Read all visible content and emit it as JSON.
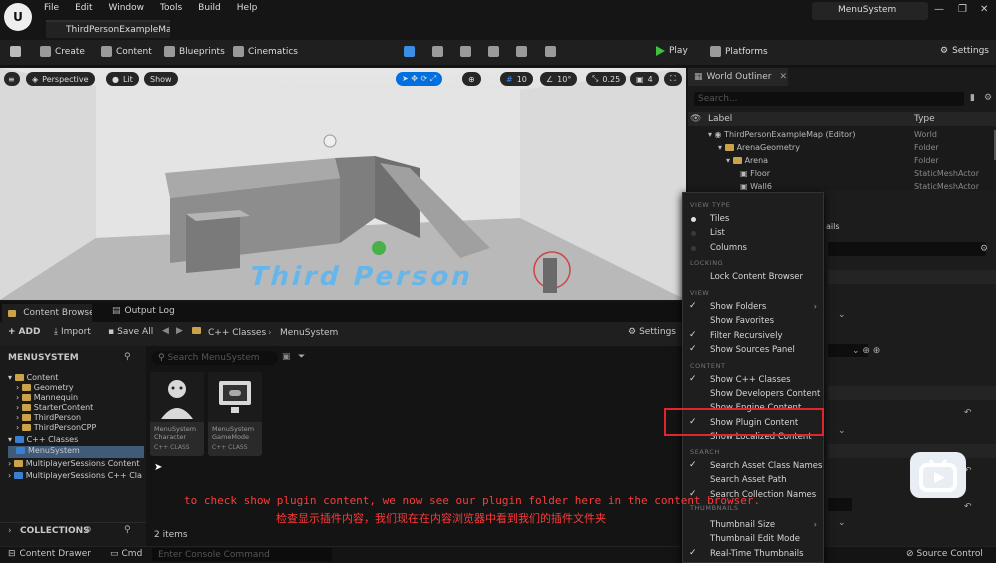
{
  "menubar": {
    "items": [
      "File",
      "Edit",
      "Window",
      "Tools",
      "Build",
      "Help"
    ],
    "project": "MenuSystem"
  },
  "doc_tab": "ThirdPersonExampleMap",
  "toolbar": {
    "create": "Create",
    "content": "Content",
    "blueprints": "Blueprints",
    "cinematics": "Cinematics",
    "play": "Play",
    "platforms": "Platforms",
    "settings": "Settings"
  },
  "viewport": {
    "perspective": "Perspective",
    "lit": "Lit",
    "show": "Show",
    "grid": "10",
    "angle": "10°",
    "scale": "0.25",
    "cams": "4",
    "floor_text": "Third Person"
  },
  "outliner": {
    "title": "World Outliner",
    "search_placeholder": "Search...",
    "col_label": "Label",
    "col_type": "Type",
    "rows": [
      {
        "label": "ThirdPersonExampleMap (Editor)",
        "type": "World"
      },
      {
        "label": "ArenaGeometry",
        "type": "Folder"
      },
      {
        "label": "Arena",
        "type": "Folder"
      },
      {
        "label": "Floor",
        "type": "StaticMeshActor"
      },
      {
        "label": "Wall6",
        "type": "StaticMeshActor"
      }
    ],
    "details_fragment": "ails"
  },
  "content_browser": {
    "tab": "Content Browser",
    "output_log": "Output Log",
    "add": "ADD",
    "import": "Import",
    "save_all": "Save All",
    "path": [
      "C++ Classes",
      "MenuSystem"
    ],
    "settings": "Settings",
    "root": "MENUSYSTEM",
    "search_placeholder": "Search MenuSystem",
    "tree": [
      "Content",
      "Geometry",
      "Mannequin",
      "StarterContent",
      "ThirdPerson",
      "ThirdPersonCPP",
      "C++ Classes",
      "MenuSystem",
      "MultiplayerSessions Content",
      "MultiplayerSessions C++ Cla"
    ],
    "items": [
      {
        "name": "MenuSystem Character",
        "type": "C++ CLASS"
      },
      {
        "name": "MenuSystem GameMode",
        "type": "C++ CLASS"
      }
    ],
    "count": "2 items",
    "collections": "COLLECTIONS"
  },
  "menu": {
    "view_type": "VIEW TYPE",
    "tiles": "Tiles",
    "list": "List",
    "columns": "Columns",
    "locking": "LOCKING",
    "lock": "Lock Content Browser",
    "view": "VIEW",
    "show_folders": "Show Folders",
    "show_favorites": "Show Favorites",
    "filter_recursively": "Filter Recursively",
    "show_sources_panel": "Show Sources Panel",
    "content": "CONTENT",
    "show_cpp": "Show C++ Classes",
    "show_developers": "Show Developers Content",
    "show_engine": "Show Engine Content",
    "show_plugin": "Show Plugin Content",
    "show_localized": "Show Localized Content",
    "search": "SEARCH",
    "search_class": "Search Asset Class Names",
    "search_path": "Search Asset Path",
    "search_collection": "Search Collection Names",
    "thumbnails": "THUMBNAILS",
    "thumb_size": "Thumbnail Size",
    "thumb_edit": "Thumbnail Edit Mode",
    "realtime": "Real-Time Thumbnails"
  },
  "status": {
    "content_drawer": "Content Drawer",
    "cmd": "Cmd",
    "console_placeholder": "Enter Console Command",
    "source_control": "Source Control"
  },
  "subtitles": {
    "en": "to check show plugin content, we now see our plugin folder here in the content browser.",
    "zh": "检查显示插件内容，我们现在在内容浏览器中看到我们的插件文件夹"
  },
  "colors": {
    "accent": "#0070e0",
    "highlight_box": "#e0262c",
    "subtitle": "#ff3a3a",
    "play": "#40c040"
  }
}
